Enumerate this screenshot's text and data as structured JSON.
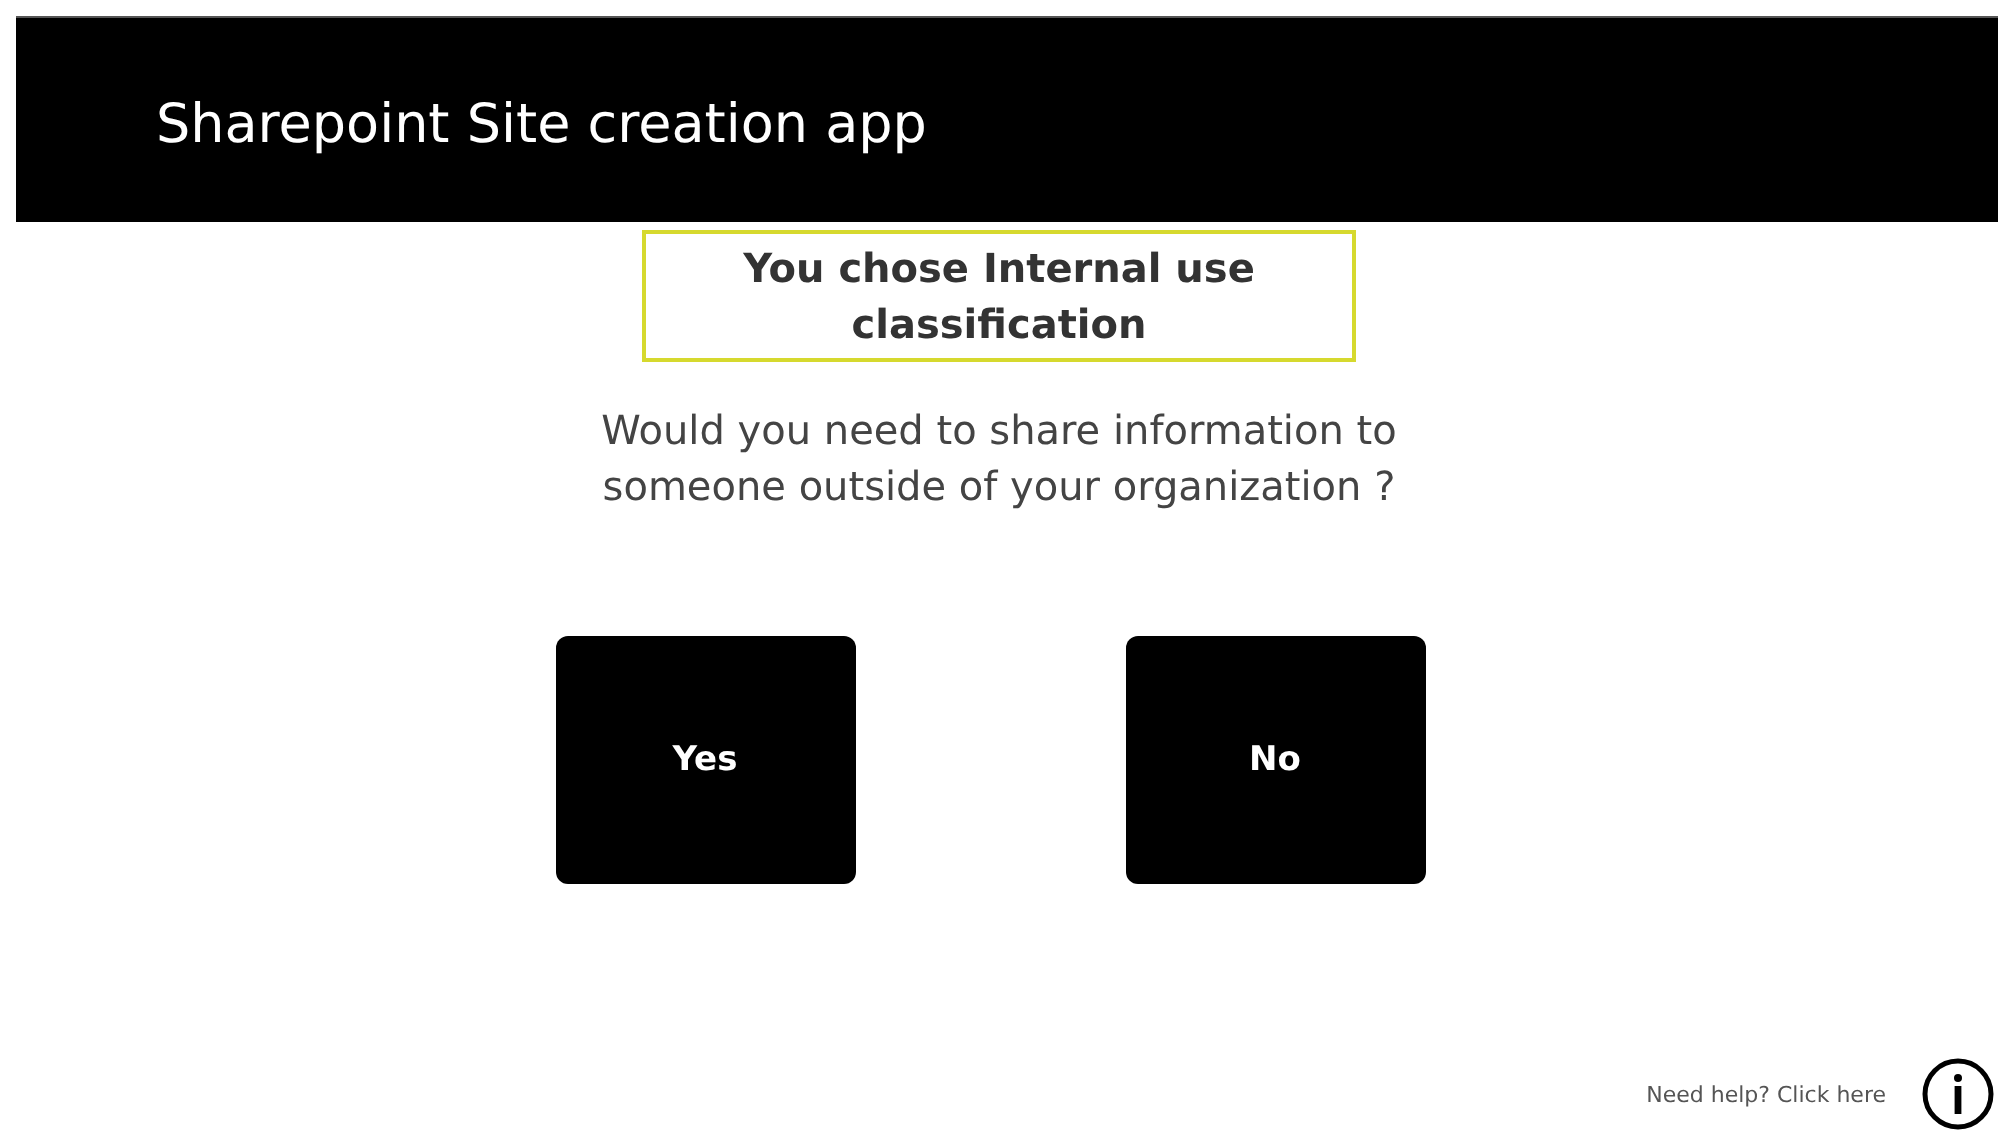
{
  "header": {
    "title": "Sharepoint Site creation app"
  },
  "classification_banner": "You chose Internal use classification",
  "question": "Would you need to share information to someone outside of your organization ?",
  "buttons": [
    {
      "label": "Yes"
    },
    {
      "label": "No"
    }
  ],
  "help": {
    "label": "Need help? Click here"
  }
}
